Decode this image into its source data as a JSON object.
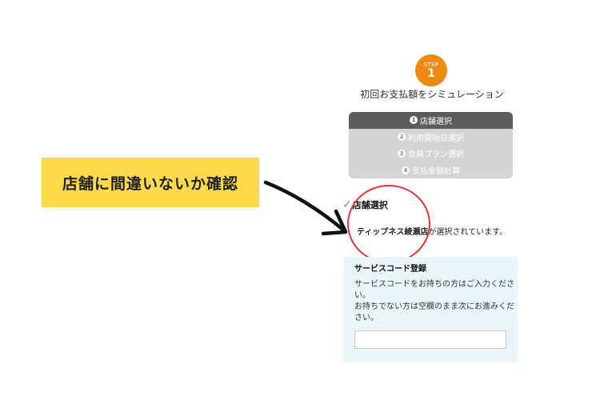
{
  "step": {
    "label": "STEP",
    "number": "1"
  },
  "sim_title": "初回お支払額をシミュレーション",
  "steps": [
    {
      "num": "1",
      "label": "店舗選択",
      "active": true
    },
    {
      "num": "2",
      "label": "利用開始日選択",
      "active": false
    },
    {
      "num": "3",
      "label": "会員プラン選択",
      "active": false
    },
    {
      "num": "4",
      "label": "支払金額計算",
      "active": false
    }
  ],
  "callout": "店舗に間違いないか確認",
  "store_section": {
    "heading": "店舗選択",
    "store_name": "ティップネス綾瀬店",
    "selected_suffix": "が選択されています。"
  },
  "service_code": {
    "title": "サービスコード登録",
    "desc_line1": "サービスコードをお持ちの方はご入力ください。",
    "desc_line2": "お持ちでない方は空欄のまま次にお進みください。",
    "input_value": ""
  },
  "colors": {
    "step_orange": "#ee8a13",
    "active_step": "#5c5c5c",
    "inactive_step": "#d4d4d4",
    "callout_yellow": "#fdd94c",
    "highlight_red": "#e8323c",
    "panel_bg": "#eaf6f9"
  }
}
